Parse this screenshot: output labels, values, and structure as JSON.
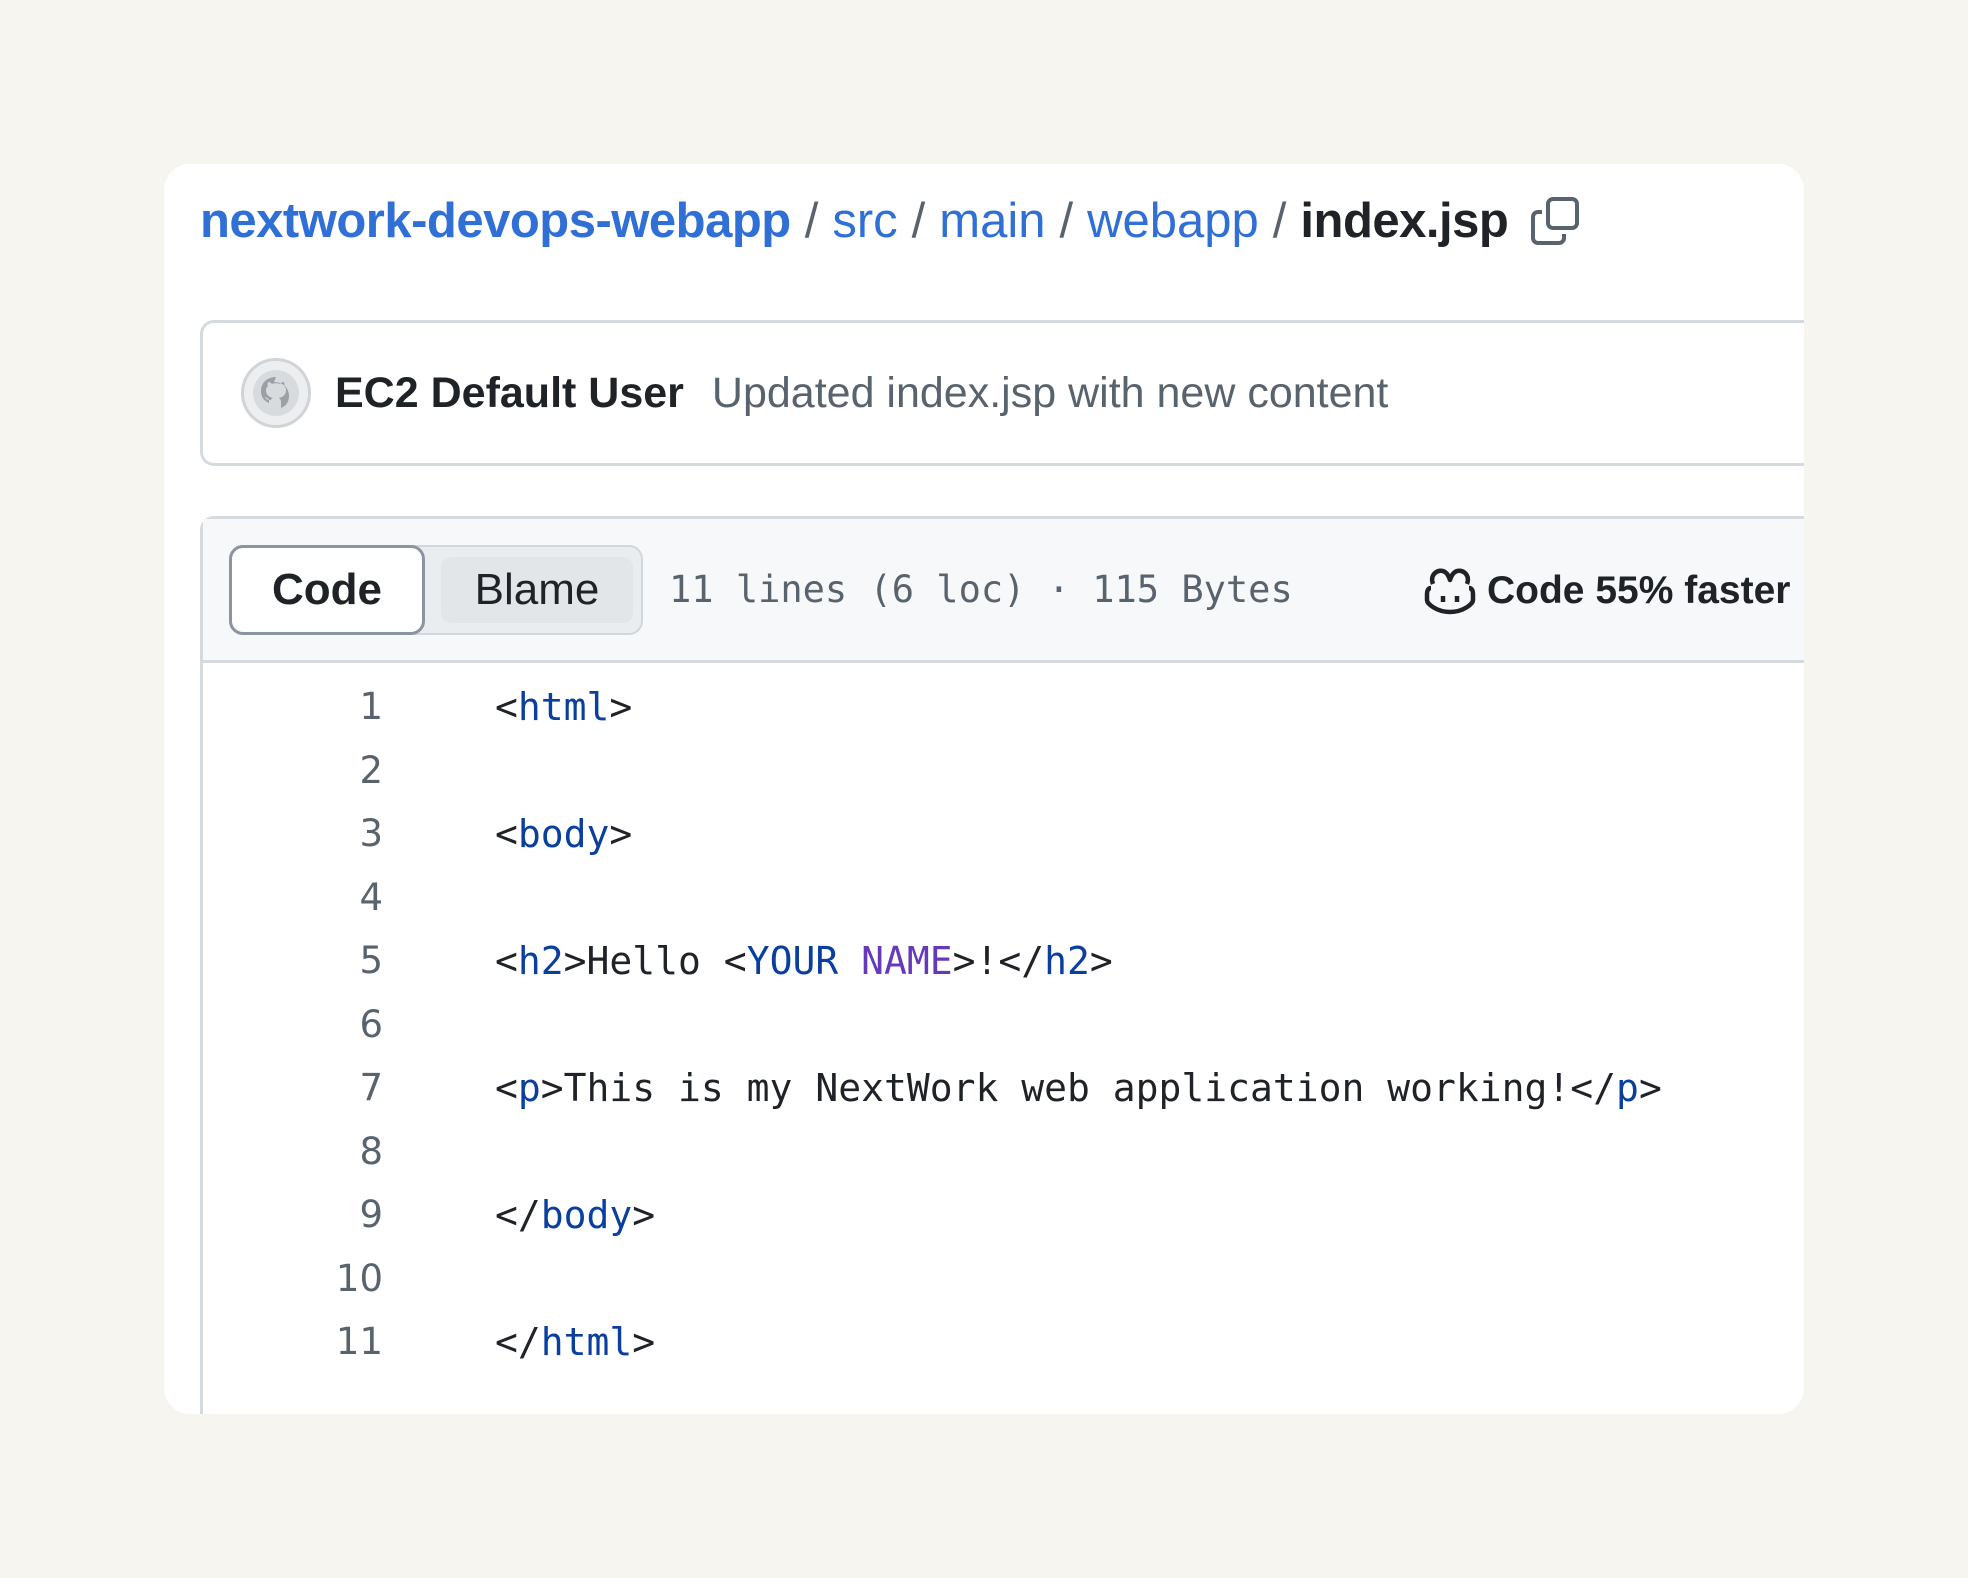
{
  "breadcrumb": {
    "repo": "nextwork-devops-webapp",
    "separator": "/",
    "paths": [
      "src",
      "main",
      "webapp"
    ],
    "file": "index.jsp",
    "copy_icon": "copy-icon"
  },
  "commit": {
    "avatar_icon": "github-octocat-icon",
    "author": "EC2 Default User",
    "message": "Updated index.jsp with new content"
  },
  "file_header": {
    "tabs": [
      {
        "label": "Code",
        "selected": true
      },
      {
        "label": "Blame",
        "selected": false
      }
    ],
    "info": "11 lines (6 loc) · 115 Bytes",
    "copilot_icon": "copilot-icon",
    "copilot_label": "Code 55% faster"
  },
  "code": {
    "line_numbers": [
      "1",
      "2",
      "3",
      "4",
      "5",
      "6",
      "7",
      "8",
      "9",
      "10",
      "11"
    ],
    "lines": [
      [
        {
          "t": "<",
          "c": "p"
        },
        {
          "t": "html",
          "c": "tag"
        },
        {
          "t": ">",
          "c": "p"
        }
      ],
      [],
      [
        {
          "t": "<",
          "c": "p"
        },
        {
          "t": "body",
          "c": "tag"
        },
        {
          "t": ">",
          "c": "p"
        }
      ],
      [],
      [
        {
          "t": "<",
          "c": "p"
        },
        {
          "t": "h2",
          "c": "tag"
        },
        {
          "t": ">Hello <",
          "c": "p"
        },
        {
          "t": "YOUR",
          "c": "tag"
        },
        {
          "t": " ",
          "c": "p"
        },
        {
          "t": "NAME",
          "c": "ent"
        },
        {
          "t": ">!</",
          "c": "p"
        },
        {
          "t": "h2",
          "c": "tag"
        },
        {
          "t": ">",
          "c": "p"
        }
      ],
      [],
      [
        {
          "t": "<",
          "c": "p"
        },
        {
          "t": "p",
          "c": "tag"
        },
        {
          "t": ">This is my NextWork web application working!</",
          "c": "p"
        },
        {
          "t": "p",
          "c": "tag"
        },
        {
          "t": ">",
          "c": "p"
        }
      ],
      [],
      [
        {
          "t": "</",
          "c": "p"
        },
        {
          "t": "body",
          "c": "tag"
        },
        {
          "t": ">",
          "c": "p"
        }
      ],
      [],
      [
        {
          "t": "</",
          "c": "p"
        },
        {
          "t": "html",
          "c": "tag"
        },
        {
          "t": ">",
          "c": "p"
        }
      ]
    ]
  },
  "colors": {
    "link": "#2f6fd6",
    "tag": "#0a3fa0",
    "entity": "#6639ba",
    "muted": "#59636e",
    "background": "#f7f5f0"
  }
}
